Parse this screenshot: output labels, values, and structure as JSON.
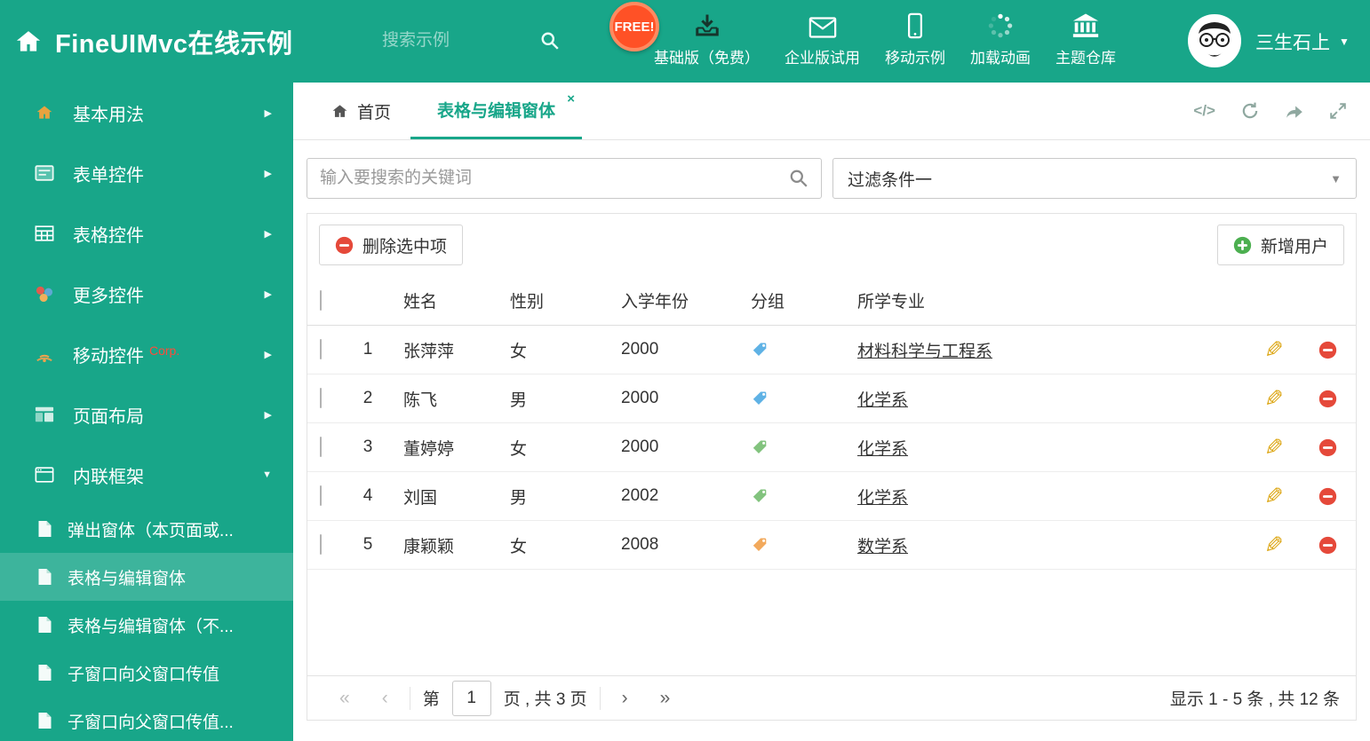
{
  "theme": {
    "green": "#18a689",
    "red": "#e5493a",
    "add_green": "#4caf50",
    "badge_orange": "#ff5126"
  },
  "icons": {
    "code": "</>",
    "close": "×",
    "caret_down": "▼",
    "chevron_right": "▶",
    "pencil": "✎",
    "first": "«",
    "prev": "‹",
    "next": "›",
    "last": "»"
  },
  "header": {
    "title": "FineUIMvc在线示例",
    "search_placeholder": "搜索示例",
    "free_badge": "FREE!",
    "nav": [
      {
        "label": "基础版（免费）"
      },
      {
        "label": "企业版试用"
      },
      {
        "label": "移动示例"
      },
      {
        "label": "加载动画"
      },
      {
        "label": "主题仓库"
      }
    ],
    "user_name": "三生石上"
  },
  "sidebar": {
    "items": [
      {
        "label": "基本用法"
      },
      {
        "label": "表单控件"
      },
      {
        "label": "表格控件"
      },
      {
        "label": "更多控件"
      },
      {
        "label": "移动控件",
        "badge": "Corp."
      },
      {
        "label": "页面布局"
      },
      {
        "label": "内联框架"
      }
    ],
    "subitems": [
      {
        "label": "弹出窗体（本页面或..."
      },
      {
        "label": "表格与编辑窗体"
      },
      {
        "label": "表格与编辑窗体（不..."
      },
      {
        "label": "子窗口向父窗口传值"
      },
      {
        "label": "子窗口向父窗口传值..."
      }
    ]
  },
  "tabs": {
    "home": "首页",
    "active": "表格与编辑窗体"
  },
  "filterbar": {
    "search_placeholder": "输入要搜索的关键词",
    "filter_selected": "过滤条件一"
  },
  "toolbar": {
    "delete": "删除选中项",
    "add": "新增用户"
  },
  "grid": {
    "columns": {
      "name": "姓名",
      "gender": "性别",
      "year": "入学年份",
      "group": "分组",
      "major": "所学专业"
    },
    "rows": [
      {
        "no": "1",
        "name": "张萍萍",
        "gender": "女",
        "year": "2000",
        "tag_color": "#5fb2e5",
        "major": "材料科学与工程系"
      },
      {
        "no": "2",
        "name": "陈飞",
        "gender": "男",
        "year": "2000",
        "tag_color": "#5fb2e5",
        "major": "化学系"
      },
      {
        "no": "3",
        "name": "董婷婷",
        "gender": "女",
        "year": "2000",
        "tag_color": "#82c37e",
        "major": "化学系"
      },
      {
        "no": "4",
        "name": "刘国",
        "gender": "男",
        "year": "2002",
        "tag_color": "#82c37e",
        "major": "化学系"
      },
      {
        "no": "5",
        "name": "康颖颖",
        "gender": "女",
        "year": "2008",
        "tag_color": "#f2a95c",
        "major": "数学系"
      }
    ]
  },
  "pagination": {
    "prefix": "第",
    "page": "1",
    "suffix": "页 , 共 3 页",
    "summary": "显示 1 - 5 条 , 共 12 条"
  }
}
